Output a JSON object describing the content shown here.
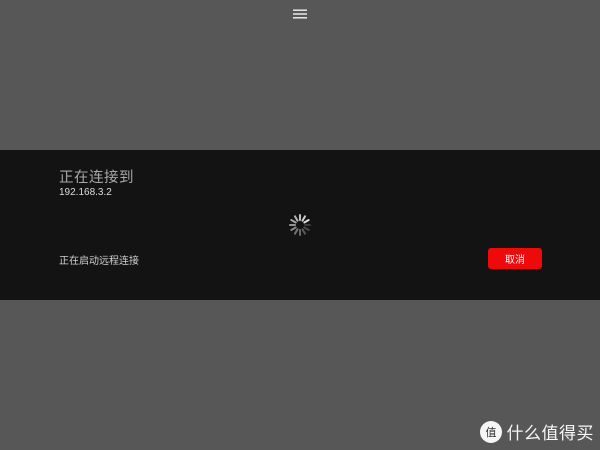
{
  "header": {
    "menu_icon": "hamburger-menu-icon"
  },
  "connection": {
    "title": "正在连接到",
    "address": "192.168.3.2",
    "status": "正在启动远程连接",
    "cancel_label": "取消",
    "spinner_icon": "loading-spinner-icon"
  },
  "colors": {
    "background": "#575757",
    "panel": "#131313",
    "accent": "#ee0a0a"
  },
  "watermark": {
    "text": "什么值得买",
    "logo_icon": "smzdm-logo-icon"
  }
}
